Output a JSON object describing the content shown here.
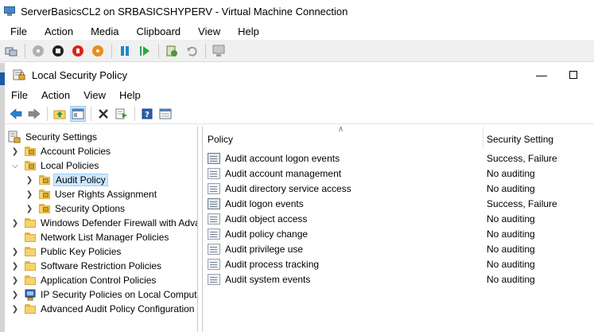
{
  "vm": {
    "title": "ServerBasicsCL2 on SRBASICSHYPERV - Virtual Machine Connection",
    "menu": [
      "File",
      "Action",
      "Media",
      "Clipboard",
      "View",
      "Help"
    ]
  },
  "mmc": {
    "title": "Local Security Policy",
    "menu": [
      "File",
      "Action",
      "View",
      "Help"
    ]
  },
  "tree": [
    {
      "label": "Security Settings",
      "level": 0,
      "chevron": "",
      "icon": "security-settings-icon"
    },
    {
      "label": "Account Policies",
      "level": 1,
      "chevron": ">",
      "icon": "folder-lock-icon"
    },
    {
      "label": "Local Policies",
      "level": 1,
      "chevron": "v",
      "icon": "folder-open-icon"
    },
    {
      "label": "Audit Policy",
      "level": 2,
      "chevron": ">",
      "icon": "folder-lock-icon",
      "selected": true
    },
    {
      "label": "User Rights Assignment",
      "level": 2,
      "chevron": ">",
      "icon": "folder-lock-icon"
    },
    {
      "label": "Security Options",
      "level": 2,
      "chevron": ">",
      "icon": "folder-lock-icon"
    },
    {
      "label": "Windows Defender Firewall with Adva",
      "level": 1,
      "chevron": ">",
      "icon": "folder-icon"
    },
    {
      "label": "Network List Manager Policies",
      "level": 1,
      "chevron": "",
      "icon": "folder-icon"
    },
    {
      "label": "Public Key Policies",
      "level": 1,
      "chevron": ">",
      "icon": "folder-icon"
    },
    {
      "label": "Software Restriction Policies",
      "level": 1,
      "chevron": ">",
      "icon": "folder-icon"
    },
    {
      "label": "Application Control Policies",
      "level": 1,
      "chevron": ">",
      "icon": "folder-icon"
    },
    {
      "label": "IP Security Policies on Local Compute",
      "level": 1,
      "chevron": ">",
      "icon": "ipsec-icon"
    },
    {
      "label": "Advanced Audit Policy Configuration",
      "level": 1,
      "chevron": ">",
      "icon": "folder-icon"
    }
  ],
  "list": {
    "columns": {
      "policy": "Policy",
      "setting": "Security Setting"
    },
    "rows": [
      {
        "policy": "Audit account logon events",
        "setting": "Success, Failure"
      },
      {
        "policy": "Audit account management",
        "setting": "No auditing"
      },
      {
        "policy": "Audit directory service access",
        "setting": "No auditing"
      },
      {
        "policy": "Audit logon events",
        "setting": "Success, Failure"
      },
      {
        "policy": "Audit object access",
        "setting": "No auditing"
      },
      {
        "policy": "Audit policy change",
        "setting": "No auditing"
      },
      {
        "policy": "Audit privilege use",
        "setting": "No auditing"
      },
      {
        "policy": "Audit process tracking",
        "setting": "No auditing"
      },
      {
        "policy": "Audit system events",
        "setting": "No auditing"
      }
    ]
  },
  "colors": {
    "selection": "#cce8ff",
    "accent": "#1c5aa6"
  }
}
